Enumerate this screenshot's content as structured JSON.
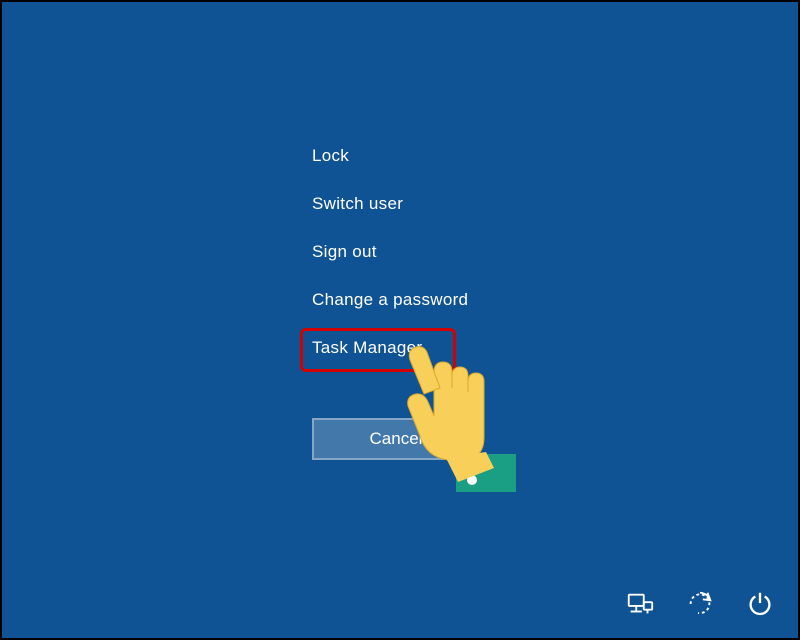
{
  "menu": {
    "items": [
      {
        "label": "Lock"
      },
      {
        "label": "Switch user"
      },
      {
        "label": "Sign out"
      },
      {
        "label": "Change a password"
      },
      {
        "label": "Task Manager"
      }
    ]
  },
  "cancel": {
    "label": "Cancel"
  },
  "annotation": {
    "highlighted_item": "Task Manager",
    "highlight_color": "#d20000",
    "pointer": "hand-cursor"
  },
  "bottom_icons": [
    {
      "name": "network-icon"
    },
    {
      "name": "ease-of-access-icon"
    },
    {
      "name": "power-icon"
    }
  ],
  "colors": {
    "background": "#0f5394",
    "text": "#ffffff",
    "button_bg": "rgba(255,255,255,0.22)"
  }
}
